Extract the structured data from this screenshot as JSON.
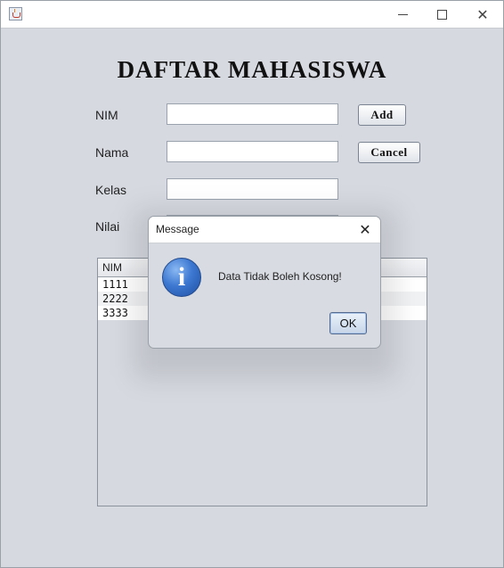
{
  "window": {
    "title": "",
    "controls": {
      "minimize": "—",
      "maximize": "☐",
      "close": "✕"
    }
  },
  "form": {
    "heading": "DAFTAR MAHASISWA",
    "fields": [
      {
        "label": "NIM",
        "value": ""
      },
      {
        "label": "Nama",
        "value": ""
      },
      {
        "label": "Kelas",
        "value": ""
      },
      {
        "label": "Nilai",
        "value": ""
      }
    ],
    "add_label": "Add",
    "cancel_label": "Cancel"
  },
  "table": {
    "columns": [
      "NIM"
    ],
    "rows": [
      [
        "1111"
      ],
      [
        "2222"
      ],
      [
        "3333"
      ]
    ]
  },
  "dialog": {
    "title": "Message",
    "close_glyph": "✕",
    "icon": "information-icon",
    "icon_glyph": "i",
    "message": "Data Tidak Boleh Kosong!",
    "ok_label": "OK"
  }
}
